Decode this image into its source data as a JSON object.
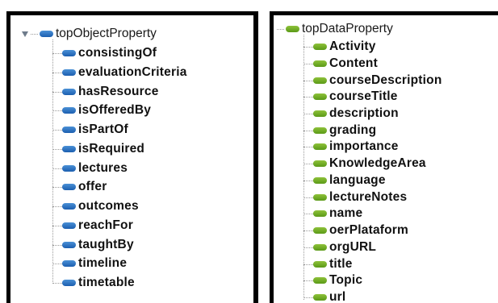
{
  "object_properties": {
    "root_label": "topObjectProperty",
    "icon": "blue-pill-icon",
    "color": "#2b6fc2",
    "items": [
      {
        "label": "consistingOf"
      },
      {
        "label": "evaluationCriteria"
      },
      {
        "label": "hasResource"
      },
      {
        "label": "isOfferedBy"
      },
      {
        "label": "isPartOf"
      },
      {
        "label": "isRequired"
      },
      {
        "label": "lectures"
      },
      {
        "label": "offer"
      },
      {
        "label": "outcomes"
      },
      {
        "label": "reachFor"
      },
      {
        "label": "taughtBy"
      },
      {
        "label": "timeline"
      },
      {
        "label": "timetable"
      }
    ]
  },
  "data_properties": {
    "root_label": "topDataProperty",
    "icon": "green-pill-icon",
    "color": "#6fae23",
    "items": [
      {
        "label": "Activity"
      },
      {
        "label": "Content"
      },
      {
        "label": "courseDescription"
      },
      {
        "label": "courseTitle"
      },
      {
        "label": "description"
      },
      {
        "label": "grading"
      },
      {
        "label": "importance"
      },
      {
        "label": "KnowledgeArea"
      },
      {
        "label": "language"
      },
      {
        "label": "lectureNotes"
      },
      {
        "label": "name"
      },
      {
        "label": "oerPlataform"
      },
      {
        "label": "orgURL"
      },
      {
        "label": "title"
      },
      {
        "label": "Topic"
      },
      {
        "label": "url"
      }
    ]
  }
}
